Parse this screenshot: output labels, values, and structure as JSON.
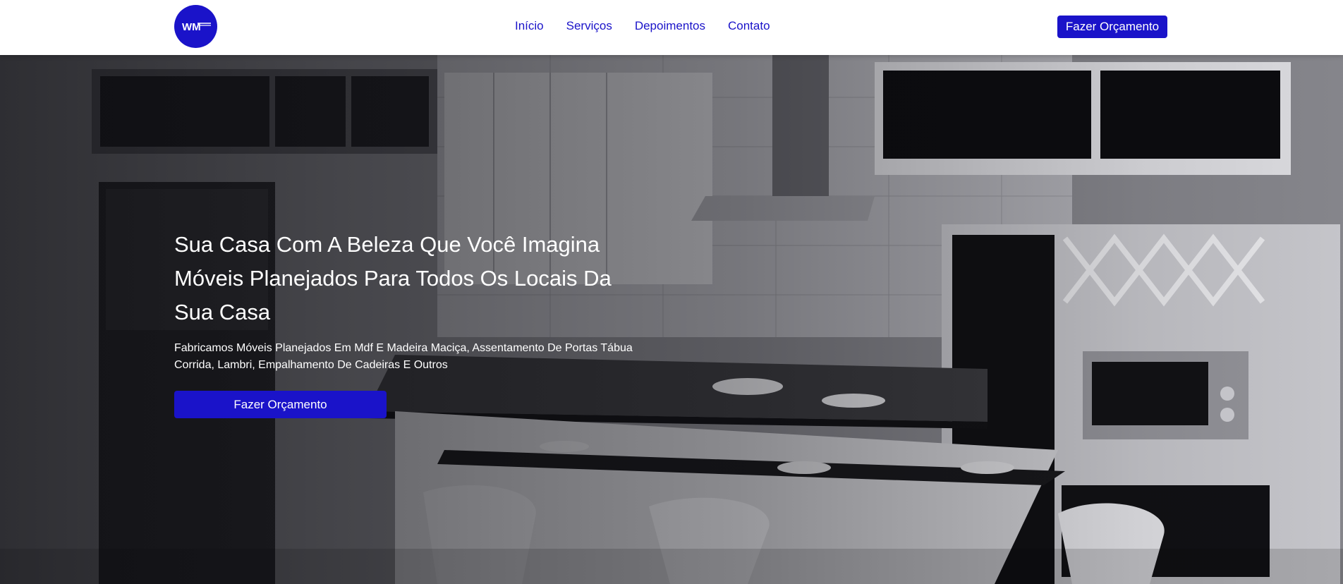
{
  "brand": {
    "logo_text": "WM",
    "color": "#1a13c9"
  },
  "nav": {
    "links": [
      {
        "label": "Início"
      },
      {
        "label": "Serviços"
      },
      {
        "label": "Depoimentos"
      },
      {
        "label": "Contato"
      }
    ],
    "cta_label": "Fazer Orçamento"
  },
  "hero": {
    "title_lines": [
      "Sua Casa Com A Beleza Que Você Imagina",
      "Móveis Planejados Para Todos Os Locais Da",
      "Sua Casa"
    ],
    "subtitle": "Fabricamos Móveis Planejados Em Mdf E Madeira Maciça, Assentamento De Portas Tábua Corrida, Lambri, Empalhamento De Cadeiras E Outros",
    "cta_label": "Fazer Orçamento",
    "background_image": "kitchen-photo"
  }
}
